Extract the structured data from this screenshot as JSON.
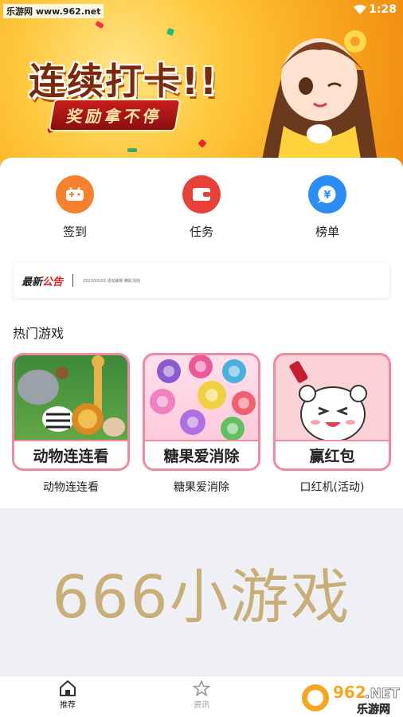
{
  "watermark": "乐游网 www.962.net",
  "status_bar": {
    "time": "1:28"
  },
  "banner": {
    "title": "连续打卡!!",
    "subtitle": "奖励拿不停"
  },
  "quick_entries": [
    {
      "label": "签到",
      "icon": "gamepad-icon",
      "color": "#f6812e"
    },
    {
      "label": "任务",
      "icon": "wallet-icon",
      "color": "#e8413a"
    },
    {
      "label": "榜单",
      "icon": "yen-chat-icon",
      "color": "#2c8df5"
    }
  ],
  "notice": {
    "title_a": "最新",
    "title_b": "公告",
    "text": "2023/03/03 活动最新 精彩活动"
  },
  "section": {
    "title": "热门游戏"
  },
  "games": [
    {
      "name": "动物连连看",
      "ribbon": "动物连连看"
    },
    {
      "name": "糖果爱消除",
      "ribbon": "糖果爱消除"
    },
    {
      "name": "口红机(活动)",
      "ribbon": "赢红包"
    }
  ],
  "promo": {
    "text": "666小游戏"
  },
  "tabs": [
    {
      "label": "推荐",
      "icon": "home-icon",
      "active": true
    },
    {
      "label": "资讯",
      "icon": "star-icon",
      "active": false
    }
  ],
  "corner_logo": {
    "number": "962",
    "suffix": ".NET",
    "text": "乐游网"
  },
  "colors": {
    "accent_pink": "#f08aa0",
    "promo_gold": "#c9ae7a",
    "banner_orange": "#f7a21b"
  }
}
